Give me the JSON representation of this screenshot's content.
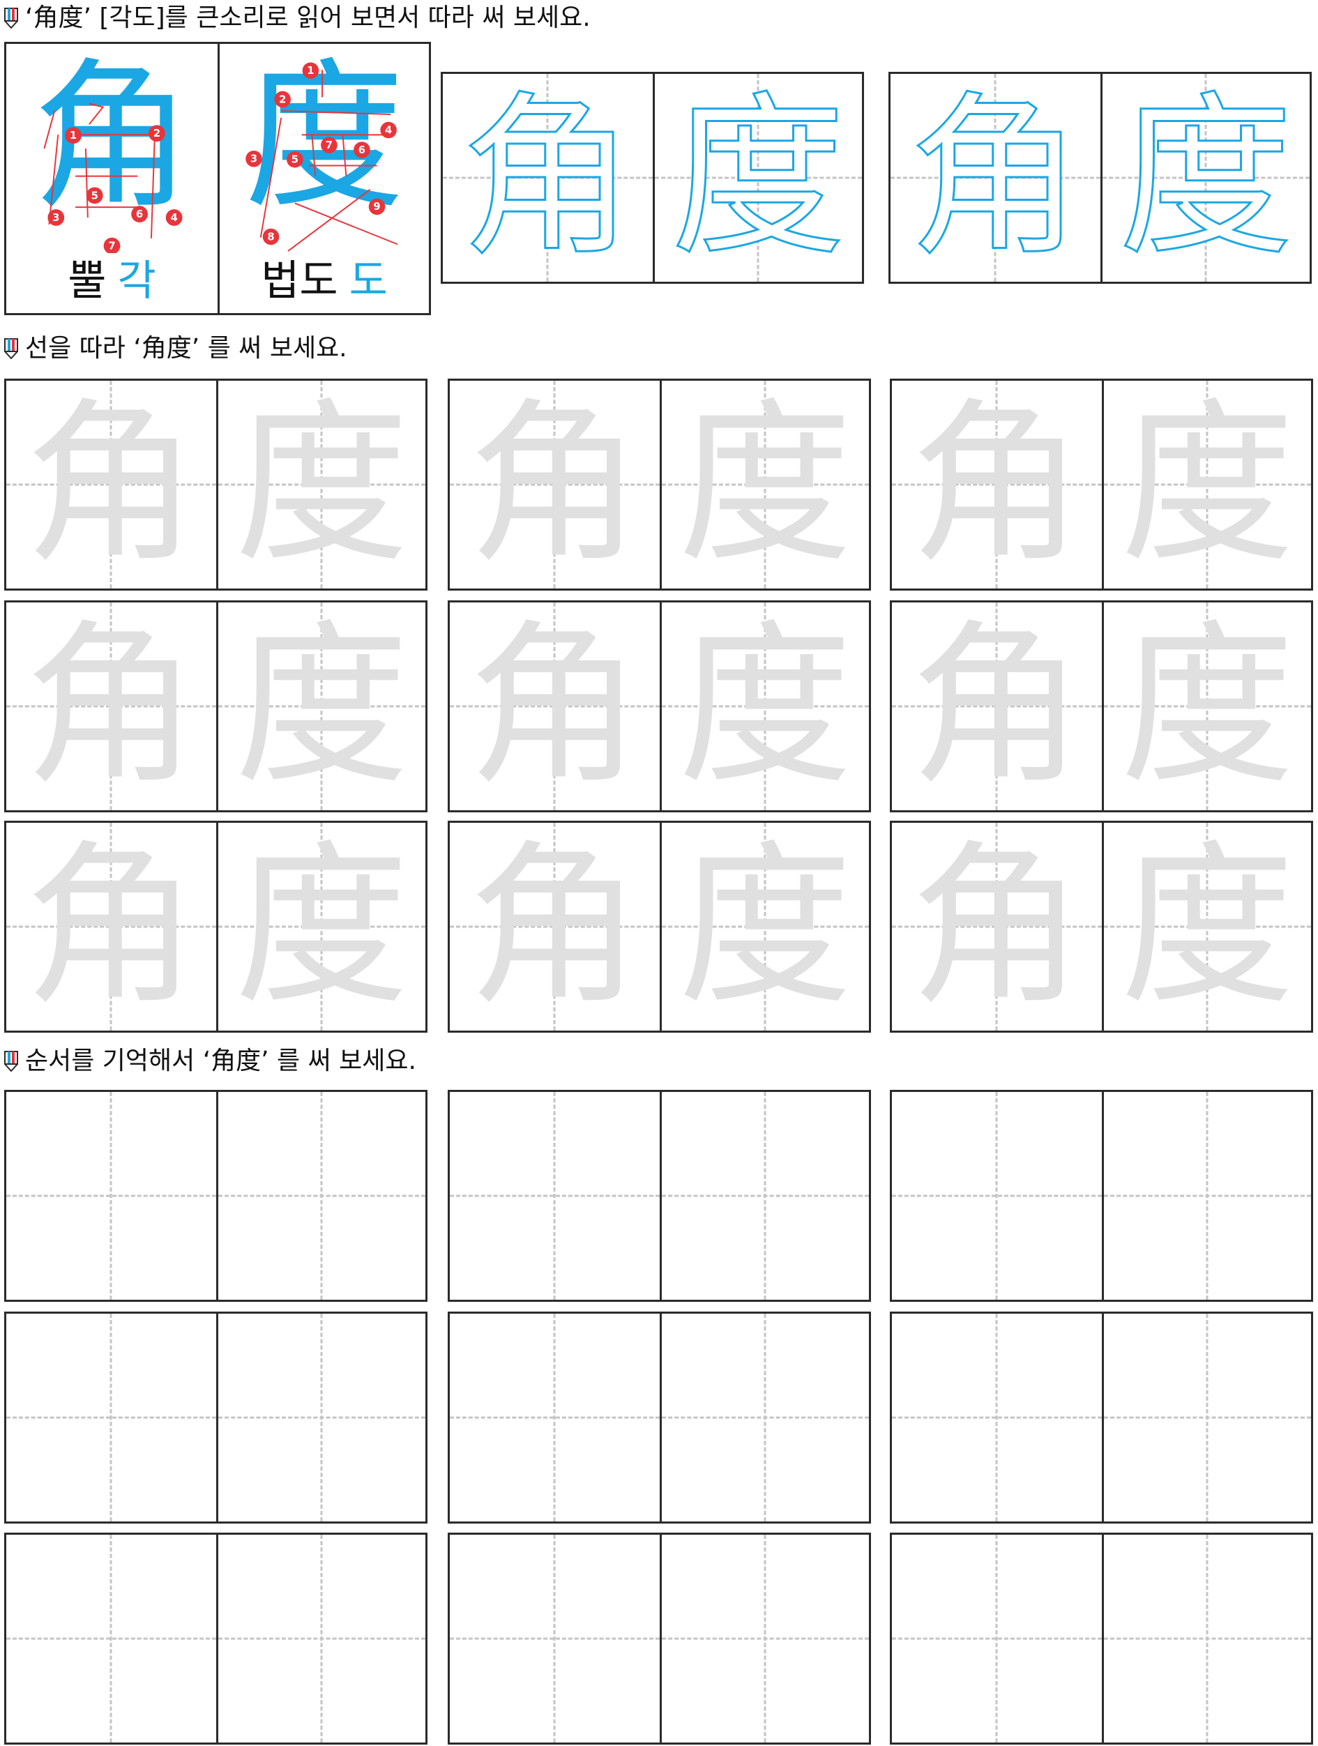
{
  "section1": {
    "instruction": "‘角度’ [각도]를 큰소리로 읽어 보면서 따라 써 보세요.",
    "characters": [
      {
        "char": "角",
        "meaning": "뿔",
        "sound": "각",
        "order_labels": [
          "1",
          "2",
          "3",
          "4",
          "5",
          "6",
          "7"
        ]
      },
      {
        "char": "度",
        "meaning": "법도",
        "sound": "도",
        "order_labels": [
          "1",
          "2",
          "3",
          "4",
          "5",
          "6",
          "7",
          "8",
          "9"
        ]
      }
    ],
    "outline_pairs": [
      [
        "角",
        "度"
      ],
      [
        "角",
        "度"
      ]
    ]
  },
  "section2": {
    "instruction": "선을 따라 ‘角度’ 를 써 보세요.",
    "pair": [
      "角",
      "度"
    ]
  },
  "section3": {
    "instruction": "순서를 기억해서 ‘角度’ 를 써 보세요."
  },
  "colors": {
    "accent_blue": "#1aa7e4",
    "stroke_order_red": "#e8343b",
    "trace_gray": "#e0e0e0",
    "guide_dash": "#c4c4c4",
    "border": "#2b2b2b"
  },
  "icons": {
    "instruction_marker": "pencil-icon"
  }
}
